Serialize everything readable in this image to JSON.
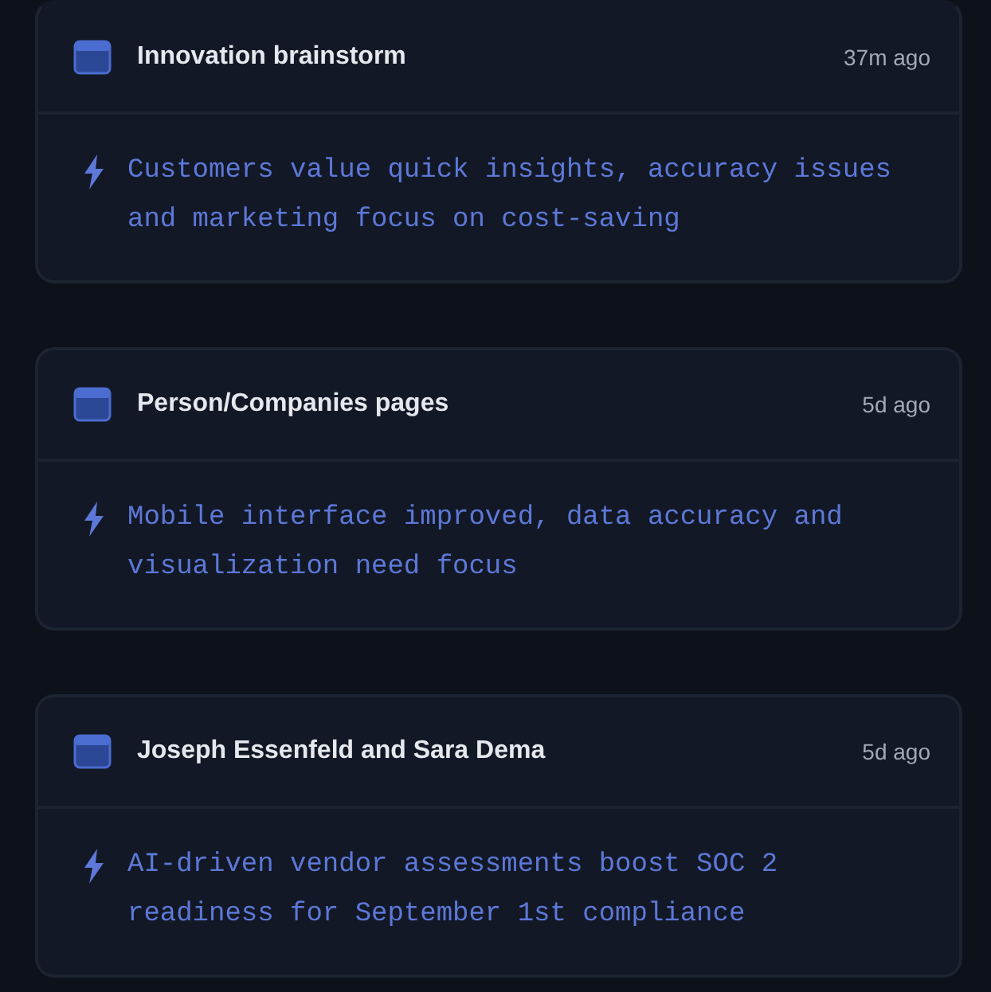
{
  "meetings": [
    {
      "title": "Innovation brainstorm",
      "time": "37m ago",
      "summary": "Customers value quick insights, accuracy issues and marketing focus on cost-saving"
    },
    {
      "title": "Person/Companies pages",
      "time": "5d ago",
      "summary": "Mobile interface improved, data accuracy and visualization need focus"
    },
    {
      "title": "Joseph Essenfeld and Sara Dema",
      "time": "5d ago",
      "summary": "AI-driven vendor assessments boost SOC 2 readiness for September 1st compliance"
    }
  ]
}
